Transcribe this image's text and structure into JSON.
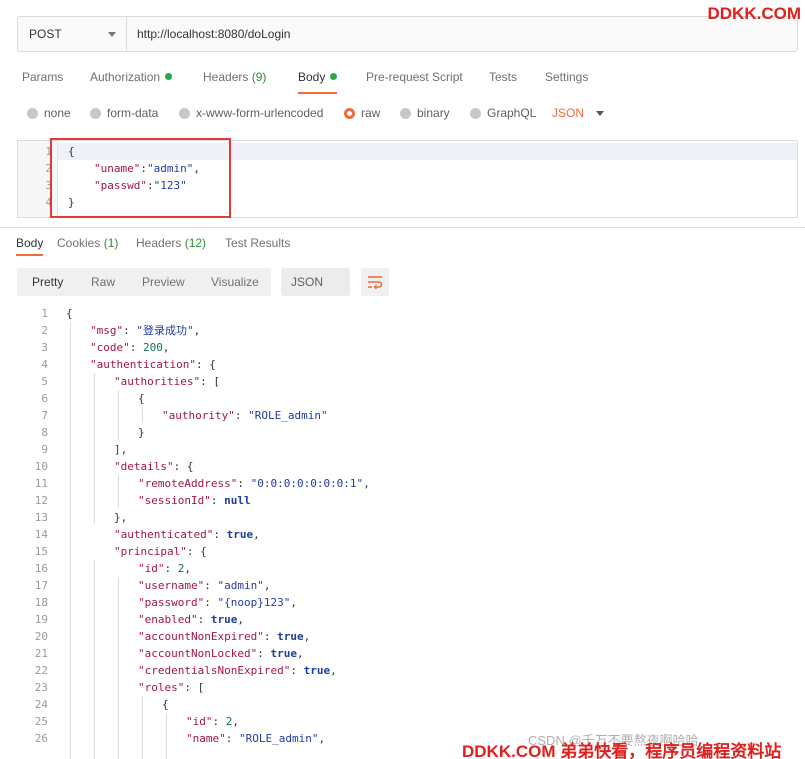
{
  "request": {
    "method": "POST",
    "url": "http://localhost:8080/doLogin"
  },
  "request_tabs": [
    {
      "label": "Params"
    },
    {
      "label": "Authorization",
      "dot": true
    },
    {
      "label": "Headers",
      "count": "(9)"
    },
    {
      "label": "Body",
      "dot": true,
      "active": true
    },
    {
      "label": "Pre-request Script"
    },
    {
      "label": "Tests"
    },
    {
      "label": "Settings"
    }
  ],
  "body_types": [
    {
      "label": "none"
    },
    {
      "label": "form-data"
    },
    {
      "label": "x-www-form-urlencoded"
    },
    {
      "label": "raw",
      "checked": true
    },
    {
      "label": "binary"
    },
    {
      "label": "GraphQL"
    }
  ],
  "body_format": "JSON",
  "request_body": {
    "line_numbers": [
      "1",
      "2",
      "3",
      "4"
    ],
    "open_brace": "{",
    "close_brace": "}",
    "uname_key": "\"uname\"",
    "uname_value": "\"admin\"",
    "passwd_key": "\"passwd\"",
    "passwd_value": "\"123\""
  },
  "response_tabs": [
    {
      "label": "Body",
      "active": true
    },
    {
      "label": "Cookies",
      "count": "(1)"
    },
    {
      "label": "Headers",
      "count": "(12)"
    },
    {
      "label": "Test Results"
    }
  ],
  "response_views": [
    "Pretty",
    "Raw",
    "Preview",
    "Visualize"
  ],
  "response_format": "JSON",
  "response_lines": [
    "{",
    "\"msg\": \"登录成功\",",
    "\"code\": 200,",
    "\"authentication\": {",
    "\"authorities\": [",
    "{",
    "\"authority\": \"ROLE_admin\"",
    "}",
    "],",
    "\"details\": {",
    "\"remoteAddress\": \"0:0:0:0:0:0:0:1\",",
    "\"sessionId\": null",
    "},",
    "\"authenticated\": true,",
    "\"principal\": {",
    "\"id\": 2,",
    "\"username\": \"admin\",",
    "\"password\": \"{noop}123\",",
    "\"enabled\": true,",
    "\"accountNonExpired\": true,",
    "\"accountNonLocked\": true,",
    "\"credentialsNonExpired\": true,",
    "\"roles\": [",
    "{",
    "\"id\": 2,",
    "\"name\": \"ROLE_admin\","
  ],
  "watermarks": {
    "top": "DDKK.COM",
    "csdn": "CSDN @千万不要熬夜啊哈哈",
    "bottom": "DDKK.COM 弟弟快看，程序员编程资料站"
  },
  "colors": {
    "accent": "#f26b3a",
    "status_dot": "#29a74a",
    "highlight_box": "#e53935",
    "watermark": "#e0201c"
  }
}
